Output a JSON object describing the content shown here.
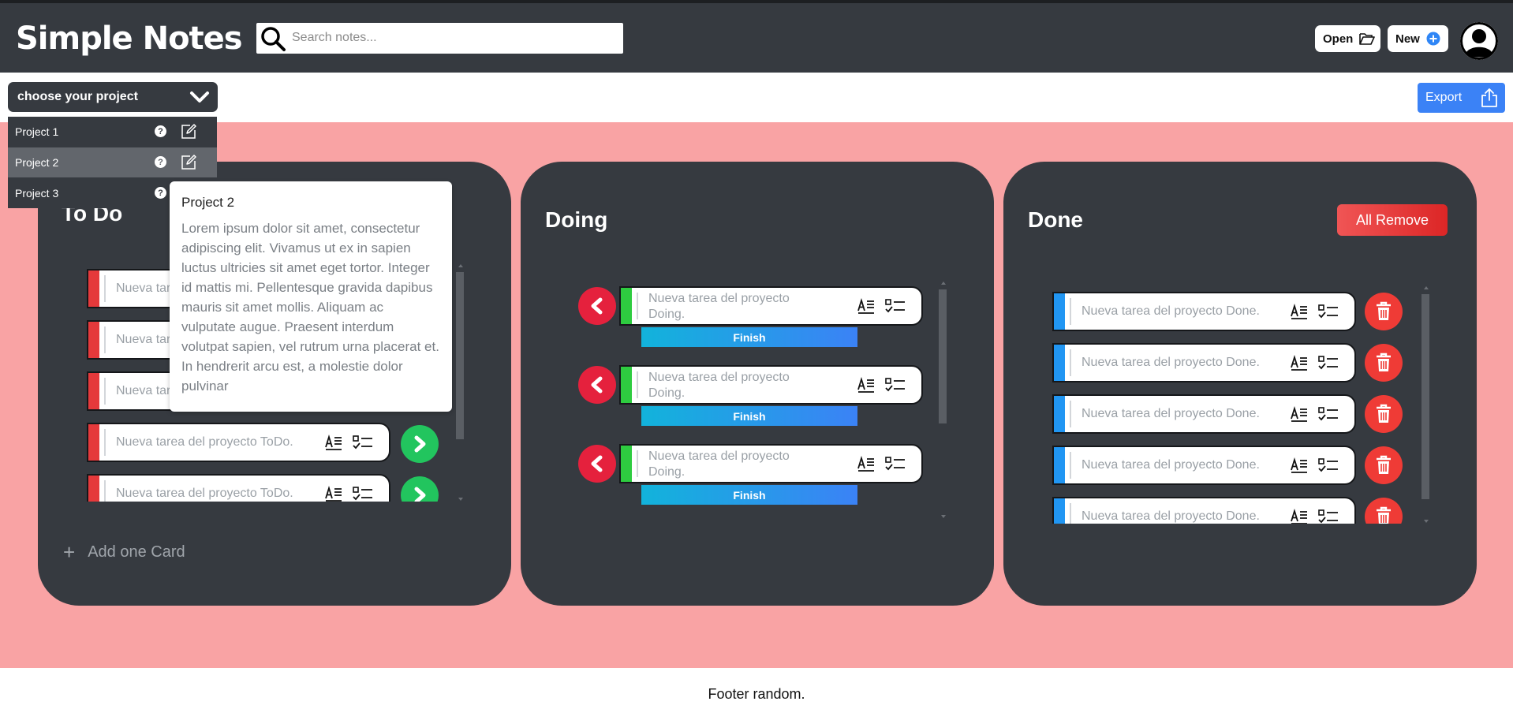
{
  "app": {
    "title": "Simple Notes",
    "search_placeholder": "Search notes...",
    "open_label": "Open",
    "new_label": "New"
  },
  "toolbar": {
    "project_select": "choose your project",
    "export_label": "Export"
  },
  "dropdown": {
    "items": [
      "Project 1",
      "Project 2",
      "Project 3"
    ],
    "active": "Project 2"
  },
  "tooltip": {
    "title": "Project 2",
    "body": "Lorem ipsum dolor sit amet, consectetur adipiscing elit. Vivamus ut ex in sapien luctus ultricies sit amet eget tortor. Integer id mattis mi. Pellentesque gravida dapibus mauris sit amet mollis. Aliquam ac vulputate augue. Praesent interdum volutpat sapien, vel rutrum urna placerat et. In hendrerit arcu est, a molestie dolor pulvinar"
  },
  "columns": {
    "todo": {
      "title": "To Do",
      "card_text": "Nueva tarea del proyecto ToDo.",
      "add_card": "Add one Card"
    },
    "doing": {
      "title": "Doing",
      "card_text": "Nueva tarea del proyecto Doing.",
      "finish_label": "Finish"
    },
    "done": {
      "title": "Done",
      "card_text": "Nueva tarea del proyecto Done.",
      "remove_all_label": "All Remove"
    }
  },
  "colors": {
    "header": "#363a40",
    "board_bg": "#f9a3a4",
    "todo_stripe": "#e5393b",
    "doing_stripe": "#2ecc40",
    "done_stripe": "#2196f3",
    "forward_button": "#22c55e",
    "back_button": "#e5213d",
    "delete_button": "#ef3b36",
    "export": "#3b82f6"
  },
  "footer": "Footer random."
}
